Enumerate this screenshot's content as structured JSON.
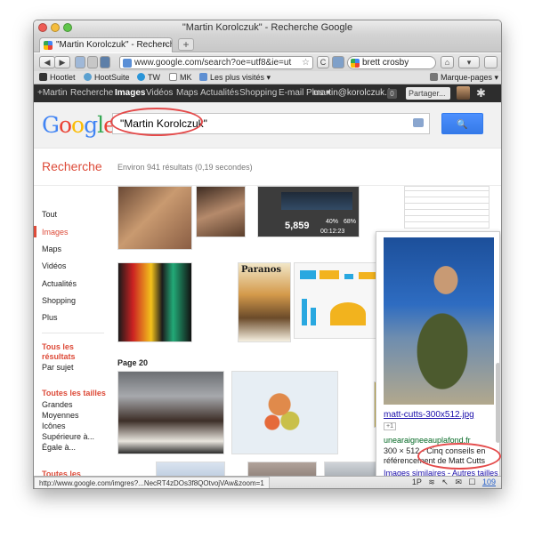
{
  "window": {
    "title": "\"Martin Korolczuk\" - Recherche Google"
  },
  "tabs": [
    {
      "label": "\"Martin Korolczuk\" - Recherche...",
      "close": "×"
    }
  ],
  "new_tab": "+",
  "nav": {
    "back": "◀",
    "forward": "▶",
    "url": "www.google.com/search?oe=utf8&ie=ut",
    "reload": "C",
    "search_engine_value": "brett crosby",
    "home_icon": "⌂",
    "dropdown": "▾"
  },
  "bookmarks": [
    {
      "label": "Hootlet",
      "color": "#333333"
    },
    {
      "label": "HootSuite",
      "color": "#5aa0d0"
    },
    {
      "label": "TW",
      "color": "#2a95d8"
    },
    {
      "label": "MK",
      "color": "#888888"
    },
    {
      "label": "Les plus visités ▾",
      "color": "#5e8fd2"
    },
    {
      "label": "Marque-pages ▾",
      "color": "#777777"
    }
  ],
  "gbar": {
    "items": [
      {
        "label": "+Martin",
        "active": false
      },
      {
        "label": "Recherche",
        "active": false
      },
      {
        "label": "Images",
        "active": true
      },
      {
        "label": "Vidéos",
        "active": false
      },
      {
        "label": "Maps",
        "active": false
      },
      {
        "label": "Actualités",
        "active": false
      },
      {
        "label": "Shopping",
        "active": false
      },
      {
        "label": "E-mail",
        "active": false
      },
      {
        "label": "Plus ▾",
        "active": false
      }
    ],
    "account": "martin@korolczuk.fr",
    "badge": "0",
    "share": "Partager..."
  },
  "search": {
    "logo": "Google",
    "query": "\"Martin Korolczuk\"",
    "button_icon": "🔍"
  },
  "subhead": {
    "section": "Recherche",
    "count": "Environ 941 résultats (0,19 secondes)"
  },
  "leftnav": {
    "main": [
      "Tout",
      "Images",
      "Maps",
      "Vidéos",
      "Actualités",
      "Shopping",
      "Plus"
    ],
    "active_index": 1,
    "results_heading": "Tous les résultats",
    "results_sub": "Par sujet",
    "size_heading": "Toutes les tailles",
    "sizes": [
      "Grandes",
      "Moyennes",
      "Icônes",
      "Supérieure à...",
      "Égale à..."
    ],
    "color_heading": "Toutes les couleurs"
  },
  "results": {
    "page_label": "Page 20",
    "stats_thumb": {
      "v1": "5,859",
      "v2": "40%",
      "v3": "00:12:23",
      "v4": "68%"
    },
    "magazine_title": "Paranos"
  },
  "preview": {
    "title": "matt-cutts-300x512.jpg",
    "plus_label": "+1",
    "domain": "unearaigneeauplafond.fr",
    "meta": "300 × 512 - Cinq conseils en référencement de Matt Cutts",
    "similar": "Images similaires",
    "sep": " - ",
    "other_sizes": "Autres tailles"
  },
  "status": {
    "url": "http://www.google.com/imgres?...NecRT4zDOs3f8QOtvojVAw&zoom=1",
    "icon_1p": "1P",
    "count": "109"
  },
  "colors": {
    "google_red": "#dd4b39",
    "link_blue": "#1a0dab",
    "url_green": "#006621",
    "search_blue": "#4d90fe",
    "annotation_red": "#e44a4a"
  }
}
